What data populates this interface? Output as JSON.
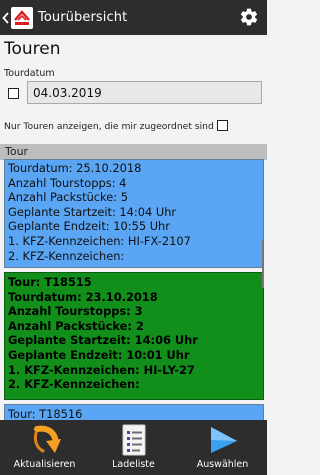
{
  "appbar": {
    "title": "Tourübersicht"
  },
  "page": {
    "title": "Touren"
  },
  "filter": {
    "date_label": "Tourdatum",
    "date_value": "04.03.2019",
    "assigned_only_label": "Nur Touren anzeigen, die mir zugeordnet sind"
  },
  "list": {
    "header": "Tour",
    "cards": [
      {
        "style": "blue",
        "lines": [
          "Tourdatum: 25.10.2018",
          "Anzahl Tourstopps: 4",
          "Anzahl Packstücke: 5",
          "Geplante Startzeit: 14:04 Uhr",
          "Geplante Endzeit: 10:55 Uhr",
          "1. KFZ-Kennzeichen: HI-FX-2107",
          "2. KFZ-Kennzeichen:"
        ]
      },
      {
        "style": "green",
        "lines": [
          "Tour: T18515",
          "Tourdatum: 23.10.2018",
          "Anzahl Tourstopps: 3",
          "Anzahl Packstücke: 2",
          "Geplante Startzeit: 14:06 Uhr",
          "Geplante Endzeit: 10:01 Uhr",
          "1. KFZ-Kennzeichen: HI-LY-27",
          "2. KFZ-Kennzeichen:"
        ]
      },
      {
        "style": "blue",
        "lines": [
          "Tour: T18516"
        ]
      }
    ]
  },
  "bottom_nav": {
    "refresh_label": "Aktualisieren",
    "loadlist_label": "Ladeliste",
    "select_label": "Auswählen"
  },
  "colors": {
    "bar": "#2d2d2d",
    "card_blue": "#5aa6f4",
    "card_selected": "#118f1a",
    "accent_orange": "#f5a020",
    "accent_blue": "#3aa0f0"
  },
  "icons": {
    "back": "chevron-left-icon",
    "logo": "app-logo",
    "settings": "gear-icon",
    "refresh": "refresh-arrow-icon",
    "loadlist": "document-list-icon",
    "select": "play-triangle-icon"
  }
}
